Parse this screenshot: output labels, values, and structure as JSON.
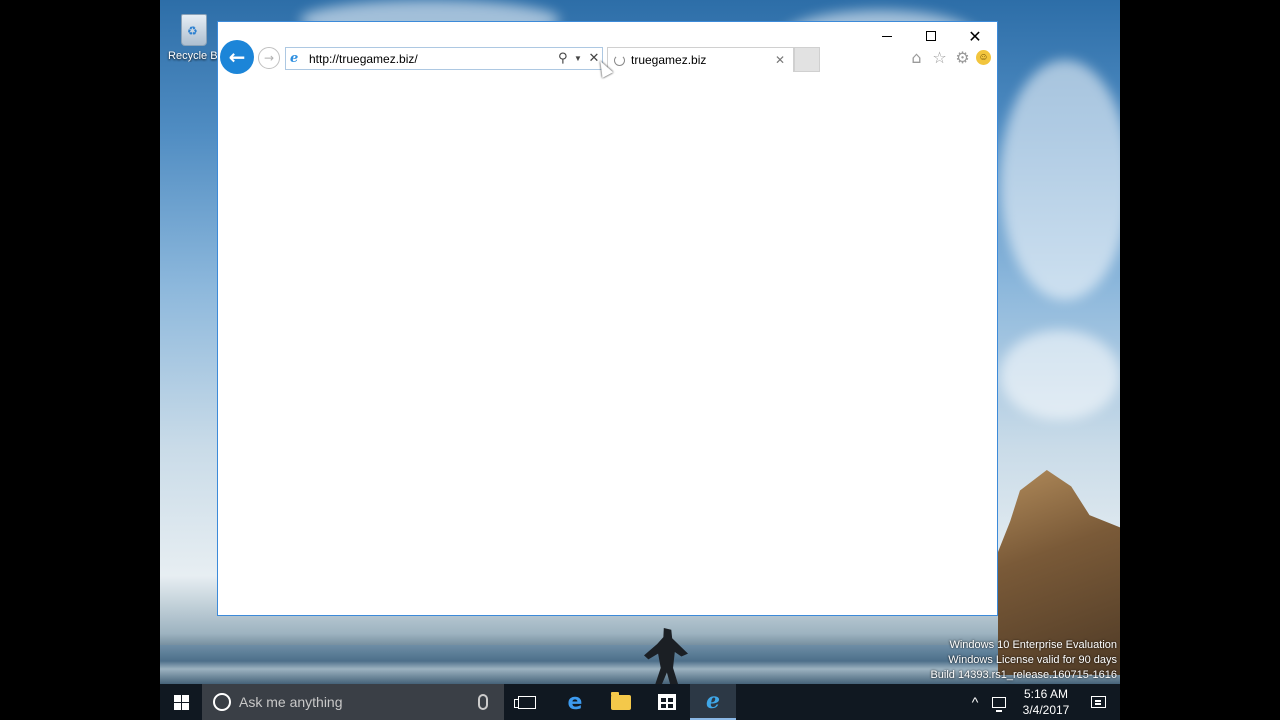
{
  "desktop": {
    "recycle_bin_label": "Recycle Bi",
    "watermark": {
      "line1": "Windows 10 Enterprise Evaluation",
      "line2": "Windows License valid for 90 days",
      "line3": "Build 14393.rs1_release.160715-1616"
    }
  },
  "browser": {
    "address": "http://truegamez.biz/",
    "tab_title": "truegamez.biz",
    "icons": {
      "back": "back-arrow-icon",
      "forward": "forward-arrow-icon",
      "search": "search-icon",
      "stop": "close-icon",
      "home": "home-icon",
      "favorites": "star-icon",
      "tools": "gear-icon",
      "feedback": "smiley-icon"
    }
  },
  "taskbar": {
    "search_placeholder": "Ask me anything",
    "clock_time": "5:16 AM",
    "clock_date": "3/4/2017",
    "accent": "#3d9bf0"
  }
}
